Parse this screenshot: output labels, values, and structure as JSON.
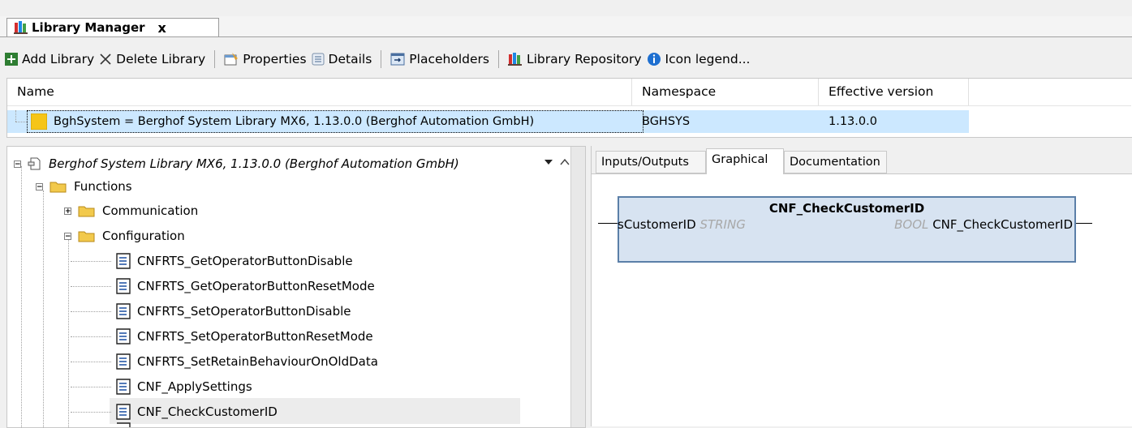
{
  "tab": {
    "title": "Library Manager",
    "close": "x"
  },
  "toolbar": {
    "add_library": "Add Library",
    "delete_library": "Delete Library",
    "properties": "Properties",
    "details": "Details",
    "placeholders": "Placeholders",
    "library_repository": "Library Repository",
    "icon_legend": "Icon legend..."
  },
  "library_table": {
    "columns": [
      "Name",
      "Namespace",
      "Effective version"
    ],
    "rows": [
      {
        "name": "BghSystem = Berghof System Library MX6, 1.13.0.0 (Berghof Automation GmbH)",
        "namespace": "BGHSYS",
        "version": "1.13.0.0"
      }
    ]
  },
  "tree": {
    "root": "Berghof System Library MX6, 1.13.0.0 (Berghof Automation GmbH)",
    "folder_functions": "Functions",
    "folder_communication": "Communication",
    "folder_configuration": "Configuration",
    "items": [
      "CNFRTS_GetOperatorButtonDisable",
      "CNFRTS_GetOperatorButtonResetMode",
      "CNFRTS_SetOperatorButtonDisable",
      "CNFRTS_SetOperatorButtonResetMode",
      "CNFRTS_SetRetainBehaviourOnOldData",
      "CNF_ApplySettings",
      "CNF_CheckCustomerID"
    ],
    "selected_item": "CNF_CheckCustomerID"
  },
  "detail_tabs": [
    "Inputs/Outputs",
    "Graphical",
    "Documentation"
  ],
  "active_detail_tab": "Graphical",
  "function_block": {
    "name": "CNF_CheckCustomerID",
    "input_name": "sCustomerID",
    "input_type": "STRING",
    "output_type": "BOOL",
    "output_name": "CNF_CheckCustomerID"
  },
  "colors": {
    "selection": "#cce8ff",
    "fb_fill": "#d7e3f1",
    "fb_border": "#5b7fa8",
    "folder": "#f2c94c"
  }
}
